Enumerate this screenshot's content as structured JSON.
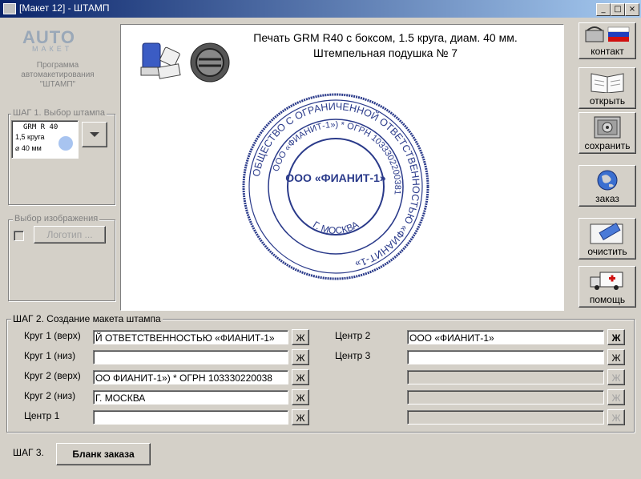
{
  "window": {
    "title": "[Макет 12] - ШТАМП",
    "minimize": "_",
    "maximize": "□",
    "close": "×"
  },
  "logo": {
    "name": "AUTO",
    "sub": "МАКЕТ",
    "desc_line1": "Программа",
    "desc_line2": "автомакетирования",
    "desc_line3": "\"ШТАМП\""
  },
  "step1": {
    "group_title": "ШАГ 1. Выбор штампа",
    "stamp_model": "GRM R 40",
    "stamp_circles": "1,5 круга",
    "stamp_diameter": "⌀ 40 мм",
    "dropdown_icon": "triangle-down-icon"
  },
  "image_select": {
    "group_title": "Выбор изображения",
    "logo_button": "Логотип ..."
  },
  "preview": {
    "title_line1": "Печать GRM R40 с боксом, 1.5 круга, диам. 40 мм.",
    "title_line2": "Штемпельная подушка № 7",
    "stamp_outer_text": "ОБЩЕСТВО С ОГРАНИЧЕННОЙ ОТВЕТСТВЕННОСТЬЮ «ФИАНИТ-1»",
    "stamp_inner_text": "ООО «ФИАНИТ-1») * ОГРН 1033302200381",
    "stamp_center": "ООО «ФИАНИТ-1»",
    "stamp_bottom": "Г. МОСКВА",
    "stamp_color": "#2a3a8a"
  },
  "side_buttons": [
    {
      "label": "контакт",
      "icon": "phone-flag-icon"
    },
    {
      "label": "открыть",
      "icon": "open-book-icon"
    },
    {
      "label": "сохранить",
      "icon": "safe-icon"
    },
    {
      "label": "заказ",
      "icon": "globe-icon"
    },
    {
      "label": "очистить",
      "icon": "eraser-icon"
    },
    {
      "label": "помощь",
      "icon": "ambulance-icon"
    }
  ],
  "step2": {
    "group_title": "ШАГ 2. Создание макета штампа",
    "bold_btn": "Ж",
    "left_fields": [
      {
        "label": "Круг 1 (верх)",
        "value": "Й ОТВЕТСТВЕННОСТЬЮ  «ФИАНИТ-1»"
      },
      {
        "label": "Круг 1 (низ)",
        "value": ""
      },
      {
        "label": "Круг 2 (верх)",
        "value": "ОО  ФИАНИТ-1») * ОГРН 103330220038"
      },
      {
        "label": "Круг 2 (низ)",
        "value": "Г. МОСКВА"
      },
      {
        "label": "Центр 1",
        "value": ""
      }
    ],
    "right_fields": [
      {
        "label": "Центр 2",
        "value": "ООО «ФИАНИТ-1»"
      },
      {
        "label": "Центр 3",
        "value": ""
      },
      {
        "label": "",
        "value": ""
      },
      {
        "label": "",
        "value": ""
      },
      {
        "label": "",
        "value": ""
      }
    ]
  },
  "step3": {
    "label": "ШАГ 3.",
    "order_button": "Бланк заказа"
  }
}
